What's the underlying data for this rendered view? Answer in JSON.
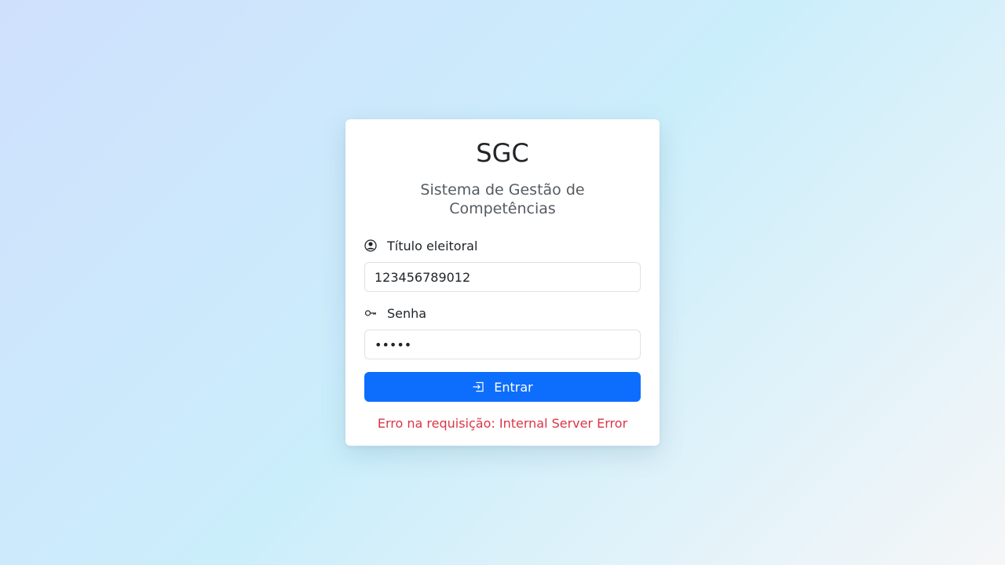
{
  "login": {
    "title": "SGC",
    "subtitle": "Sistema de Gestão de Competências",
    "username": {
      "label": "Título eleitoral",
      "value": "123456789012",
      "icon": "person-circle-icon"
    },
    "password": {
      "label": "Senha",
      "value": "12345",
      "icon": "key-icon"
    },
    "submit": {
      "label": "Entrar",
      "icon": "box-arrow-in-right-icon",
      "color": "#0d6efd"
    },
    "error_message": "Erro na requisição: Internal Server Error",
    "error_color": "#dc3545"
  }
}
